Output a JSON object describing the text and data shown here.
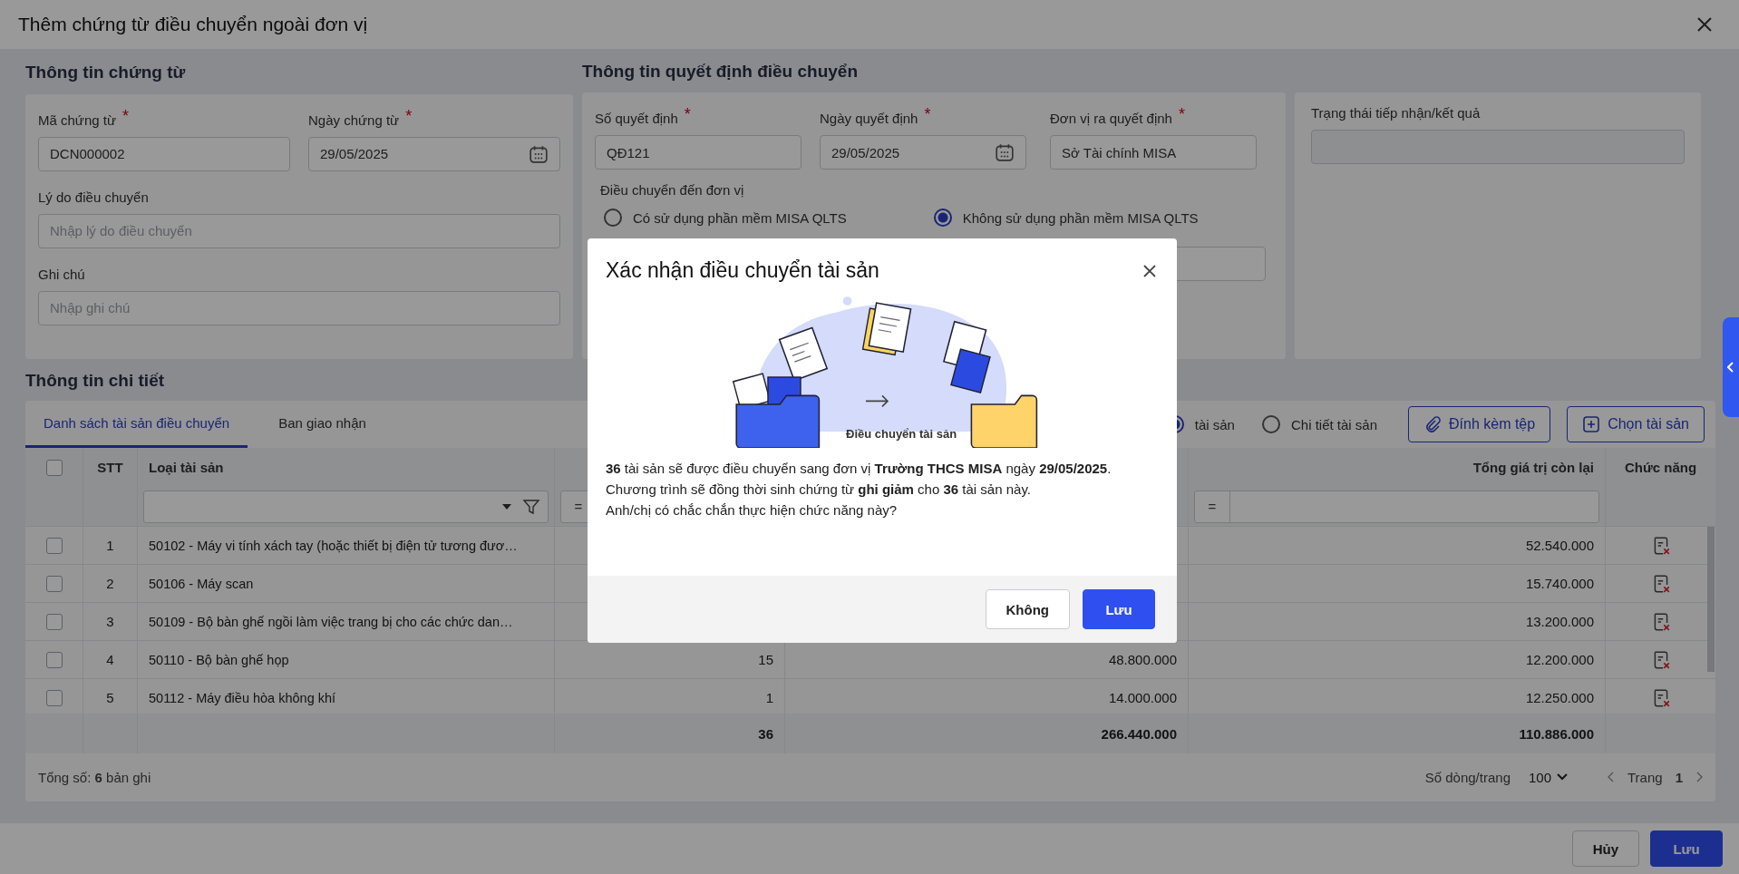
{
  "window": {
    "title": "Thêm chứng từ điều chuyển ngoài đơn vị"
  },
  "voucher_section": {
    "title": "Thông tin chứng từ",
    "rows": [
      [
        {
          "label": "Mã chứng từ",
          "required_mark": "*",
          "kind": "text",
          "value": "DCN000002"
        },
        {
          "label": "Ngày chứng từ",
          "required_mark": "*",
          "kind": "date",
          "value": "29/05/2025"
        }
      ],
      [
        {
          "label": "Lý do điều chuyển",
          "kind": "text",
          "placeholder": "Nhập lý do điều chuyển"
        }
      ],
      [
        {
          "label": "Ghi chú",
          "kind": "text",
          "placeholder": "Nhập ghi chú"
        }
      ]
    ]
  },
  "decision_section": {
    "title": "Thông tin quyết định điều chuyển",
    "fields": [
      {
        "label": "Số quyết định",
        "required_mark": "*",
        "kind": "text",
        "value": "QĐ121"
      },
      {
        "label": "Ngày quyết định",
        "required_mark": "*",
        "kind": "date",
        "value": "29/05/2025"
      },
      {
        "label": "Đơn vị ra quyết định",
        "required_mark": "*",
        "kind": "text",
        "value": "Sở Tài chính MISA"
      }
    ],
    "destination": {
      "label": "Điều chuyển đến đơn vị",
      "options": [
        {
          "label": "Có sử dụng phần mềm MISA QLTS",
          "selected": false
        },
        {
          "label": "Không sử dụng phần mềm MISA QLTS",
          "selected": true
        }
      ]
    }
  },
  "status_section": {
    "label": "Trạng thái tiếp nhận/kết quả"
  },
  "detail": {
    "title": "Thông tin chi tiết",
    "tabs": [
      {
        "label": "Danh sách tài sản điều chuyển",
        "selected": true
      },
      {
        "label": "Ban giao nhận",
        "selected": false
      }
    ],
    "view_options": [
      {
        "label": "tài sản",
        "selected": true
      },
      {
        "label": "Chi tiết tài sản",
        "selected": false
      }
    ],
    "actions": [
      {
        "label": "Đính kèm tệp",
        "kind": "attach"
      },
      {
        "label": "Chọn tài sản",
        "kind": "add"
      }
    ],
    "table": {
      "all_checked": false,
      "columns": [
        {
          "label": "STT"
        },
        {
          "label": "Loại tài sản",
          "filter": {
            "kind": "select"
          }
        },
        {
          "filter": {
            "kind": "compare",
            "operator": "="
          }
        },
        {},
        {
          "label": "Tổng giá trị còn lại",
          "filter": {
            "kind": "compare",
            "operator": "="
          }
        },
        {
          "label": "Chức năng"
        }
      ],
      "rows": [
        {
          "checked": false,
          "stt": "1",
          "type": "50102 - Máy vi tính xách tay (hoặc thiết bị điện tử tương đươ…",
          "remaining": "52.540.000"
        },
        {
          "checked": false,
          "stt": "2",
          "type": "50106 - Máy scan",
          "remaining": "15.740.000"
        },
        {
          "checked": false,
          "stt": "3",
          "type": "50109 - Bộ bàn ghế ngồi làm việc trang bị cho các chức dan…",
          "remaining": "13.200.000"
        },
        {
          "checked": false,
          "stt": "4",
          "type": "50110 - Bộ bàn ghế họp",
          "quantity": "15",
          "original": "48.800.000",
          "remaining": "12.200.000"
        },
        {
          "checked": false,
          "stt": "5",
          "type": "50112 - Máy điều hòa không khí",
          "quantity": "1",
          "original": "14.000.000",
          "remaining": "12.250.000"
        }
      ],
      "totals": {
        "quantity": "36",
        "original": "266.440.000",
        "remaining": "110.886.000"
      }
    },
    "summary": "Tổng số: **6** bản ghi",
    "pagination": {
      "page_size_label": "Số dòng/trang",
      "page_size": "100",
      "page_label": "Trang",
      "page": "1"
    }
  },
  "footer_buttons": [
    {
      "label": "Hủy",
      "kind": "secondary"
    },
    {
      "label": "Lưu",
      "kind": "primary"
    }
  ],
  "modal": {
    "title": "Xác nhận điều chuyển tài sản",
    "illustration_caption": "Điều chuyển tài sản",
    "lines": [
      "**36** tài sản sẽ được điều chuyển sang đơn vị **Trường THCS MISA** ngày **29/05/2025**.",
      "Chương trình sẽ đồng thời sinh chứng từ **ghi giảm** cho **36** tài sản này.",
      "Anh/chị có chắc chắn thực hiện chức năng này?"
    ],
    "buttons": [
      {
        "label": "Không",
        "kind": "secondary"
      },
      {
        "label": "Lưu",
        "kind": "primary"
      }
    ]
  }
}
